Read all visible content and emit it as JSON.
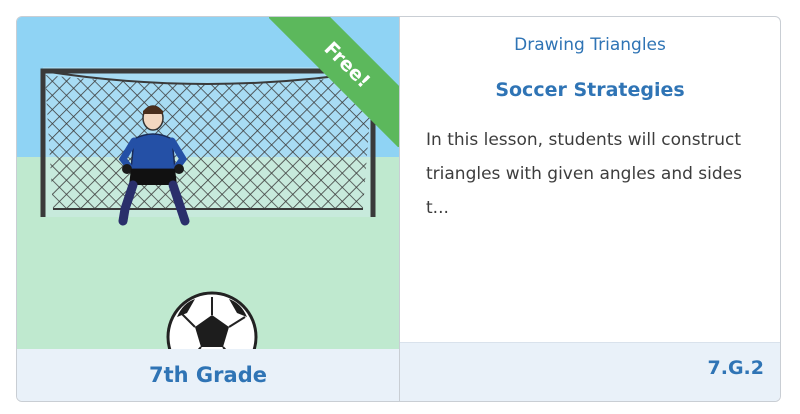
{
  "card": {
    "ribbon_label": "Free!",
    "subject": "Drawing Triangles",
    "title": "Soccer Strategies",
    "description": "In this lesson, students will construct triangles with given angles and sides t...",
    "grade": "7th Grade",
    "standard": "7.G.2",
    "thumbnail_icon": "soccer-goalkeeper-illustration"
  },
  "colors": {
    "accent": "#2f74b5",
    "ribbon": "#5cb85c",
    "footer_bg": "#e9f1f9",
    "sky": "#8fd3f4",
    "grass": "#bfe9cf"
  }
}
